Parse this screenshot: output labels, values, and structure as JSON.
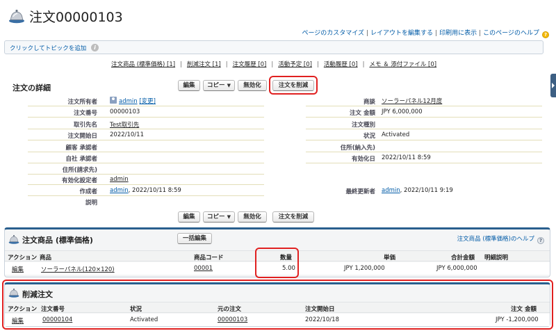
{
  "header": {
    "title": "注文00000103",
    "links": [
      "ページのカスタマイズ",
      "レイアウトを編集する",
      "印刷用に表示",
      "このページのヘルプ"
    ],
    "help_badge": "?"
  },
  "topic_bar": {
    "label": "クリックしてトピックを追加",
    "info_glyph": "i"
  },
  "related_links": [
    "注文商品 (標準価格) [1]",
    "削減注文 [1]",
    "注文履歴 [0]",
    "活動予定 [0]",
    "活動履歴 [0]",
    "メモ ＆ 添付ファイル [0]"
  ],
  "detail": {
    "title": "注文の詳細",
    "buttons": {
      "edit": "編集",
      "copy": "コピー",
      "deactivate": "無効化",
      "delete": "注文を削減",
      "dropdown_arrow": "▼"
    },
    "left_fields": [
      {
        "label": "注文所有者",
        "value": "admin",
        "extra": "[変更]"
      },
      {
        "label": "注文番号",
        "value": "00000103"
      },
      {
        "label": "取引先名",
        "value": "Test取引先"
      },
      {
        "label": "注文開始日",
        "value": "2022/10/11"
      },
      {
        "label": "顧客 承認者",
        "value": ""
      },
      {
        "label": "自社 承認者",
        "value": ""
      },
      {
        "label": "住所(請求先)",
        "value": ""
      },
      {
        "label": "有効化設定者",
        "value": "admin"
      },
      {
        "label": "作成者",
        "value": "admin",
        "extra": ", 2022/10/11 8:59"
      },
      {
        "label": "説明",
        "value": ""
      }
    ],
    "right_fields": [
      {
        "label": "商談",
        "value": "ソーラーパネル12月度"
      },
      {
        "label": "注文 金額",
        "value": "JPY 6,000,000"
      },
      {
        "label": "注文種別",
        "value": ""
      },
      {
        "label": "状況",
        "value": "Activated"
      },
      {
        "label": "住所(納入先)",
        "value": ""
      },
      {
        "label": "有効化日",
        "value": "2022/10/11 8:59"
      },
      {
        "label": "最終更新者",
        "value": "admin",
        "extra": ", 2022/10/11 9:19"
      }
    ]
  },
  "order_products": {
    "title": "注文商品 (標準価格)",
    "bulk_edit": "一括編集",
    "help_link": "注文商品 (標準価格)のヘルプ",
    "columns": [
      "アクション",
      "商品",
      "商品コード",
      "数量",
      "単価",
      "合計金額",
      "明細説明"
    ],
    "rows": [
      {
        "action": "編集",
        "product": "ソーラーパネル(120×120)",
        "code": "00001",
        "qty": "5.00",
        "unit_price": "JPY 1,200,000",
        "total": "JPY 6,000,000",
        "desc": ""
      }
    ]
  },
  "reduction_orders": {
    "title": "削減注文",
    "columns": [
      "アクション",
      "注文番号",
      "状況",
      "元の注文",
      "注文開始日",
      "注文 金額"
    ],
    "rows": [
      {
        "action": "編集",
        "order_no": "00000104",
        "status": "Activated",
        "original": "00000103",
        "start": "2022/10/18",
        "amount": "JPY -1,200,000"
      }
    ]
  },
  "colors": {
    "accent": "#295f8e",
    "link": "#015ba7",
    "highlight": "#e02020"
  }
}
